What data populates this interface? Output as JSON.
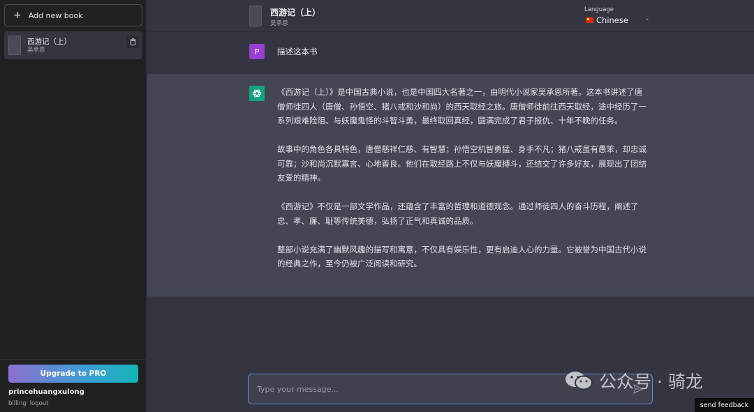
{
  "sidebar": {
    "add_label": "Add new book",
    "books": [
      {
        "title": "西游记（上）",
        "author": "吴承恩"
      }
    ],
    "upgrade_label": "Upgrade to PRO",
    "username": "princehuangxulong",
    "links": [
      "billing",
      "logout"
    ]
  },
  "header": {
    "title": "西游记（上）",
    "author": "吴承恩",
    "language_label": "Language",
    "language_value": "Chinese"
  },
  "conversation": {
    "user_initial": "P",
    "user_message": "描述这本书",
    "ai_paragraphs": [
      "《西游记（上）》是中国古典小说，也是中国四大名著之一，由明代小说家吴承恩所著。这本书讲述了唐僧师徒四人（唐僧、孙悟空、猪八戒和沙和尚）的西天取经之旅。唐僧师徒前往西天取经，途中经历了一系列艰难险阻、与妖魔鬼怪的斗智斗勇，最终取回真经，圆满完成了君子报仇、十年不晚的任务。",
      "故事中的角色各具特色，唐僧慈祥仁慈、有智慧；孙悟空机智勇猛、身手不凡；猪八戒虽有愚笨，却忠诚可靠；沙和尚沉默寡言、心地善良。他们在取经路上不仅与妖魔搏斗，还结交了许多好友，展现出了团结友爱的精神。",
      "《西游记》不仅是一部文学作品，还蕴含了丰富的哲理和道德观念。通过师徒四人的奋斗历程，阐述了忠、孝、廉、耻等传统美德，弘扬了正气和真诚的品质。",
      "整部小说充满了幽默风趣的描写和寓意，不仅具有娱乐性，更有启迪人心的力量。它被誉为中国古代小说的经典之作，至今仍被广泛阅读和研究。"
    ]
  },
  "input": {
    "placeholder": "Type your message..."
  },
  "watermark": "公众号 · 骑龙",
  "feedback_label": "send feedback",
  "colors": {
    "user_avatar": "#9a3dd6",
    "ai_avatar": "#10a37f",
    "input_border": "#5b8fd6"
  }
}
